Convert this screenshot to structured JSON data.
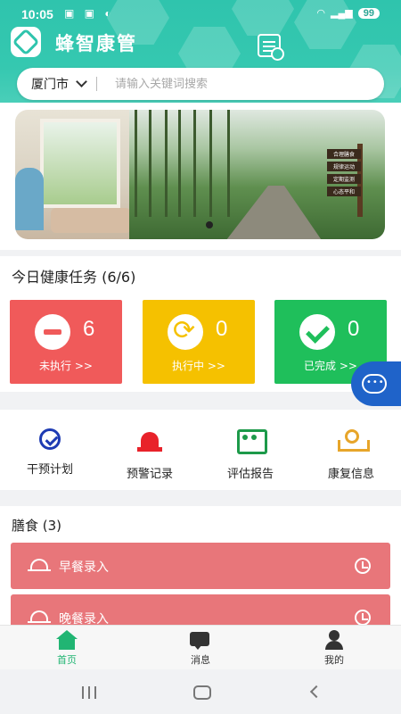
{
  "status_bar": {
    "time": "10:05",
    "battery": "99"
  },
  "header": {
    "app_title": "蜂智康管"
  },
  "search": {
    "city": "厦门市",
    "placeholder": "请输入关键词搜索"
  },
  "banner": {
    "sign_labels": [
      "合理膳食",
      "规律运动",
      "定期监测",
      "心态平和"
    ]
  },
  "tasks": {
    "title": "今日健康任务 (6/6)",
    "cards": [
      {
        "count": "6",
        "label": "未执行 >>",
        "color": "#f05a5a"
      },
      {
        "count": "0",
        "label": "执行中 >>",
        "color": "#f5c100"
      },
      {
        "count": "0",
        "label": "已完成 >>",
        "color": "#1fbf5b"
      }
    ]
  },
  "quick_menu": [
    {
      "label": "干预计划",
      "icon": "intervention-plan-icon"
    },
    {
      "label": "预警记录",
      "icon": "alarm-siren-icon"
    },
    {
      "label": "评估报告",
      "icon": "assessment-report-icon"
    },
    {
      "label": "康复信息",
      "icon": "rehab-info-icon"
    }
  ],
  "meals": {
    "title": "膳食 (3)",
    "items": [
      {
        "label": "早餐录入"
      },
      {
        "label": "晚餐录入"
      }
    ]
  },
  "tabbar": [
    {
      "label": "首页",
      "active": true,
      "color": "#21b573"
    },
    {
      "label": "消息",
      "active": false
    },
    {
      "label": "我的",
      "active": false
    }
  ],
  "colors": {
    "brand": "#35c8b0",
    "meal_row": "#e8767a",
    "chat_fab": "#1f63c9"
  }
}
